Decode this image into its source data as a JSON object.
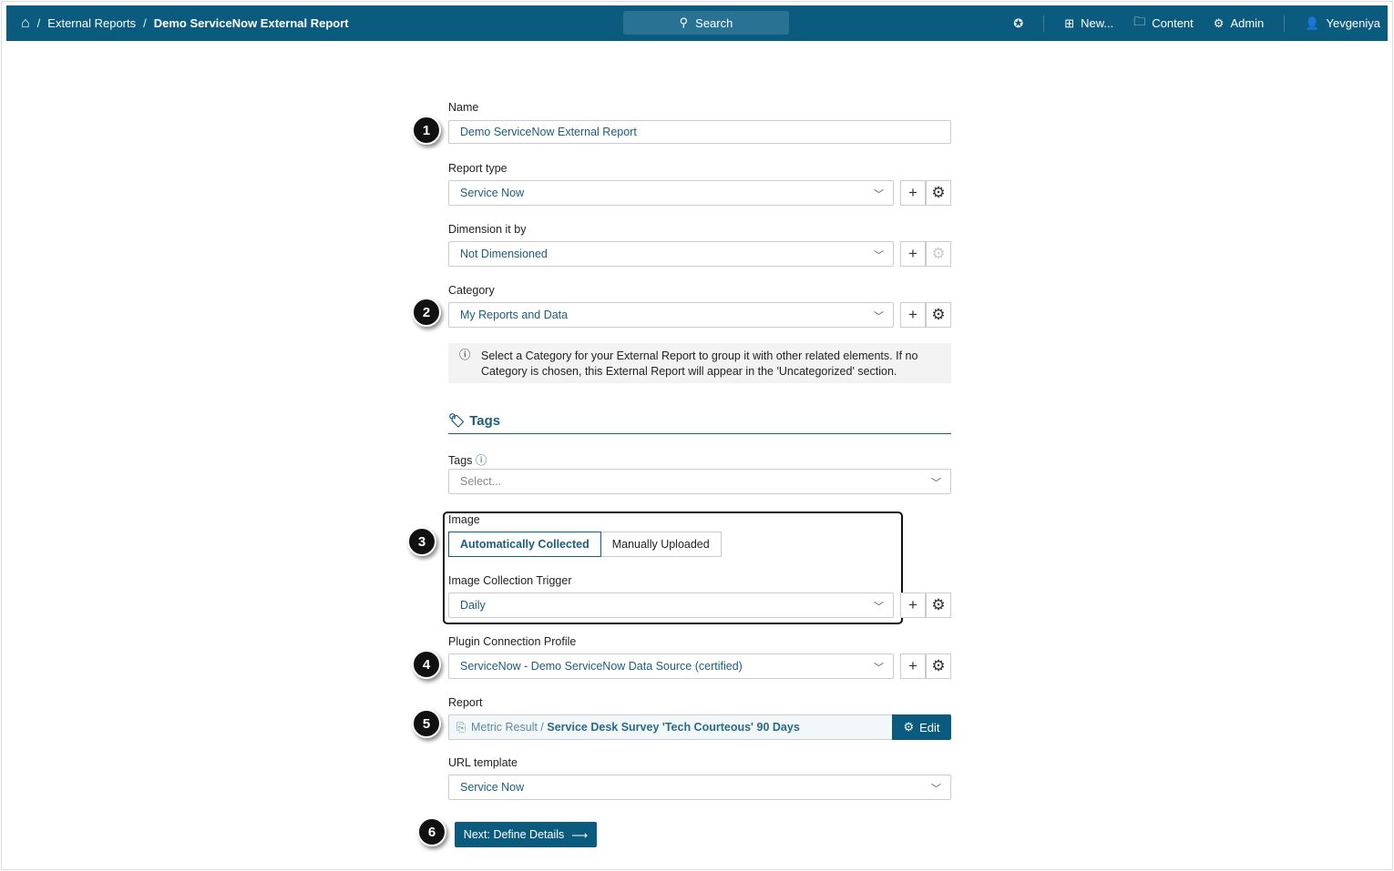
{
  "header": {
    "breadcrumb": [
      "External Reports",
      "Demo ServiceNow External Report"
    ],
    "search_label": "Search",
    "new_label": "New...",
    "content_label": "Content",
    "admin_label": "Admin",
    "user_label": "Yevgeniya"
  },
  "form": {
    "name_label": "Name",
    "name_value": "Demo ServiceNow External Report",
    "report_type_label": "Report type",
    "report_type_value": "Service Now",
    "dimension_label": "Dimension it by",
    "dimension_value": "Not Dimensioned",
    "category_label": "Category",
    "category_value": "My Reports and Data",
    "category_note": "Select a Category for your External Report to group it with other related elements. If no Category is chosen, this External Report will appear in the 'Uncategorized' section.",
    "tags_section": "Tags",
    "tags_label": "Tags",
    "tags_placeholder": "Select...",
    "image_label": "Image",
    "image_options": [
      "Automatically Collected",
      "Manually Uploaded"
    ],
    "trigger_label": "Image Collection Trigger",
    "trigger_value": "Daily",
    "plugin_label": "Plugin Connection Profile",
    "plugin_value": "ServiceNow - Demo ServiceNow Data Source (certified)",
    "report_label": "Report",
    "report_prefix": "Metric Result /",
    "report_name": "Service Desk Survey 'Tech Courteous' 90 Days",
    "edit_label": "Edit",
    "url_label": "URL template",
    "url_value": "Service Now",
    "next_label": "Next: Define Details"
  },
  "badges": [
    "1",
    "2",
    "3",
    "4",
    "5",
    "6"
  ],
  "colors": {
    "header": "#0b5b7e",
    "value_text": "#1c5c7c"
  }
}
